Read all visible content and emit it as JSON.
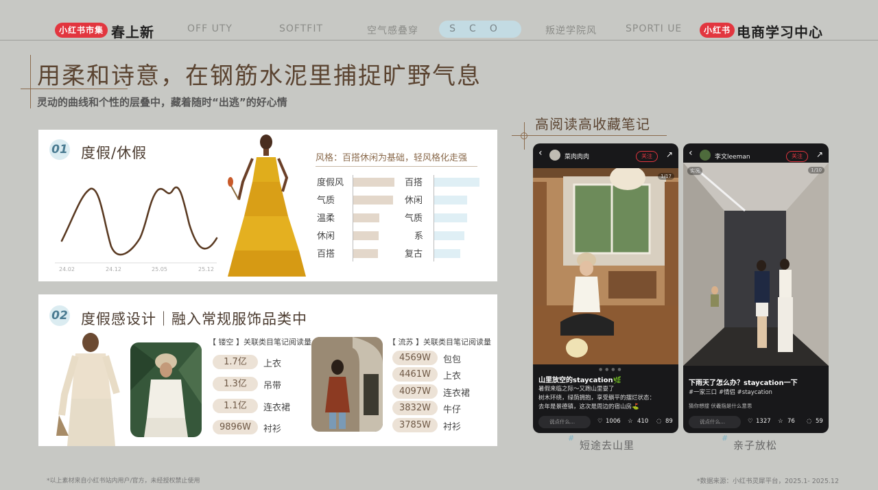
{
  "header": {
    "left_badge": "小红书市集",
    "left_title": "春上新",
    "tabs": [
      {
        "label": "OFF   UTY",
        "active": false
      },
      {
        "label": "SOFTFIT",
        "active": false
      },
      {
        "label": "空气感叠穿",
        "active": false
      },
      {
        "label": "SCO",
        "active": true
      },
      {
        "label": "叛逆学院风",
        "active": false
      },
      {
        "label": "SPORTI   UE",
        "active": false
      }
    ],
    "right_badge": "小红书",
    "right_title": "电商学习中心",
    "colors": {
      "brand_red": "#e2363f",
      "active_tab": "#c3dbe3"
    }
  },
  "title": {
    "main": "用柔和诗意，在钢筋水泥里捕捉旷野气息",
    "sub": "灵动的曲线和个性的层叠中，藏着随时“出逃”的好心情"
  },
  "card1": {
    "number": "01",
    "title": "度假/休假",
    "style_note": "风格：百搭休闲为基础，轻风格化走强",
    "trend_ticks": [
      "24.02",
      "24.12",
      "25.05",
      "25.12"
    ],
    "left_keywords": [
      {
        "label": "度假风",
        "value": 1.0
      },
      {
        "label": "气质",
        "value": 0.96
      },
      {
        "label": "温柔",
        "value": 0.64
      },
      {
        "label": "休闲",
        "value": 0.62
      },
      {
        "label": "百搭",
        "value": 0.6
      }
    ],
    "right_keywords": [
      {
        "label": "百搭",
        "value": 1.0
      },
      {
        "label": "休闲",
        "value": 0.72
      },
      {
        "label": "气质",
        "value": 0.72
      },
      {
        "label": "系",
        "value": 0.66
      },
      {
        "label": "复古",
        "value": 0.58
      }
    ],
    "colors": {
      "line": "#5a3a22",
      "beige_bar": "#e3d7ca",
      "blue_bar": "#dfeff5"
    }
  },
  "card2": {
    "number": "02",
    "title": "度假感设计｜融入常规服饰品类中",
    "group_a": {
      "heading": "【 镂空 】关联类目笔记阅读量",
      "items": [
        {
          "value": "1.7亿",
          "label": "上衣"
        },
        {
          "value": "1.3亿",
          "label": "吊带"
        },
        {
          "value": "1.1亿",
          "label": "连衣裙"
        },
        {
          "value": "9896W",
          "label": "衬衫"
        }
      ]
    },
    "group_b": {
      "heading": "【 流苏 】关联类目笔记阅读量",
      "items": [
        {
          "value": "4569W",
          "label": "包包"
        },
        {
          "value": "4461W",
          "label": "上衣"
        },
        {
          "value": "4097W",
          "label": "连衣裙"
        },
        {
          "value": "3832W",
          "label": "牛仔"
        },
        {
          "value": "3785W",
          "label": "衬衫"
        }
      ]
    }
  },
  "notes": {
    "title": "高阅读高收藏笔记",
    "phones": [
      {
        "user": "菜肉肉肉",
        "follow": "关注",
        "page": "1/17",
        "post_title": "山里放空的staycation🌿",
        "post_body": "暑假来临之际～又跑山里耍了\n树木环绕，绿荫拥抱，享受躺平的摆烂状态：\n去年是景德镇，这次是周边的宿山房⛳",
        "comment_placeholder": "说点什么...",
        "likes": "1006",
        "stars": "410",
        "comments": "89",
        "caption": "短途去山里"
      },
      {
        "user": "李文leeman",
        "follow": "关注",
        "page": "1/10",
        "tag": "实况",
        "post_title": "下雨天了怎么办？staycation一下",
        "post_body": "#一家三口 #情侣 #staycation",
        "search_hint": "猜你想搜  伏羲指是什么意思",
        "comment_placeholder": "说点什么...",
        "likes": "1327",
        "stars": "76",
        "comments": "59",
        "caption": "亲子放松"
      }
    ]
  },
  "footer": {
    "left": "*以上素材来自小红书站内用户/官方，未经授权禁止使用",
    "right": "*数据来源：小红书灵犀平台，2025.1- 2025.12"
  }
}
